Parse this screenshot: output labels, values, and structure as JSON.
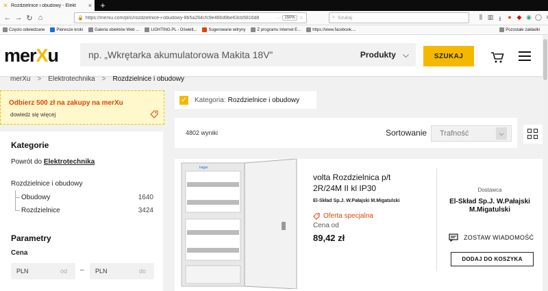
{
  "browser": {
    "tab_title": "Rozdzielnice i obudowy - Elekt",
    "url": "https://merxu.com/pl/c/rozdzielnice-i-obudowy-8b5a284cfc9e466d9be63cb5816d8",
    "zoom": "150%",
    "search_placeholder": "Szukaj",
    "bookmarks": [
      "Często odwiedzane",
      "Pierwsze kroki",
      "Galeria obiektów Web ...",
      "LIGHTING.PL - Oświetl...",
      "Sugerowane witryny",
      "Z programu Internet E...",
      "https://www.facebook...."
    ],
    "other_bookmarks": "Pozostałe zakładki"
  },
  "header": {
    "logo_a": "mer",
    "logo_x": "X",
    "logo_b": "u",
    "search_placeholder": "np. „Wkrętarka akumulatorowa Makita 18V”",
    "category": "Produkty",
    "search_button": "SZUKAJ"
  },
  "breadcrumb": {
    "items": [
      "merXu",
      "Elektrotechnika",
      "Rozdzielnice i obudowy"
    ],
    "sep": ">"
  },
  "promo": {
    "title": "Odbierz 500 zł na zakupy na merXu",
    "subtitle": "dowiedz się więcej"
  },
  "sidebar": {
    "categories_title": "Kategorie",
    "back_prefix": "Powrót do ",
    "back_link": "Elektrotechnika",
    "current_category": "Rozdzielnice i obudowy",
    "subcategories": [
      {
        "label": "Obudowy",
        "count": "1640"
      },
      {
        "label": "Rozdzielnice",
        "count": "3424"
      }
    ],
    "params_title": "Parametry",
    "price_label": "Cena",
    "price_currency": "PLN",
    "price_from_ph": "od",
    "price_to_ph": "do",
    "price_dash": "–"
  },
  "filter_chip": {
    "label": "Kategoria:",
    "value": "Rozdzielnice i obudowy"
  },
  "results": {
    "count": "4802 wyniki",
    "sort_label": "Sortowanie",
    "sort_value": "Trafność"
  },
  "product": {
    "name": "volta Rozdzielnica p/t 2R/24M II kl IP30",
    "seller": "El-Skład Sp.J. W.Pałajski M.Migatulski",
    "offer": "Oferta specjalna",
    "price_from": "Cena od",
    "price": "89,42 zł",
    "delivery_label": "Dostawca",
    "delivery_seller": "El-Skład Sp.J. W.Pałajski M.Migatulski",
    "message_button": "ZOSTAW WIADOMOŚĆ",
    "add_to_cart": "DODAJ DO KOSZYKA",
    "brand_mark": "hager"
  },
  "colors": {
    "accent": "#f5b800",
    "promo_text": "#e04500"
  }
}
